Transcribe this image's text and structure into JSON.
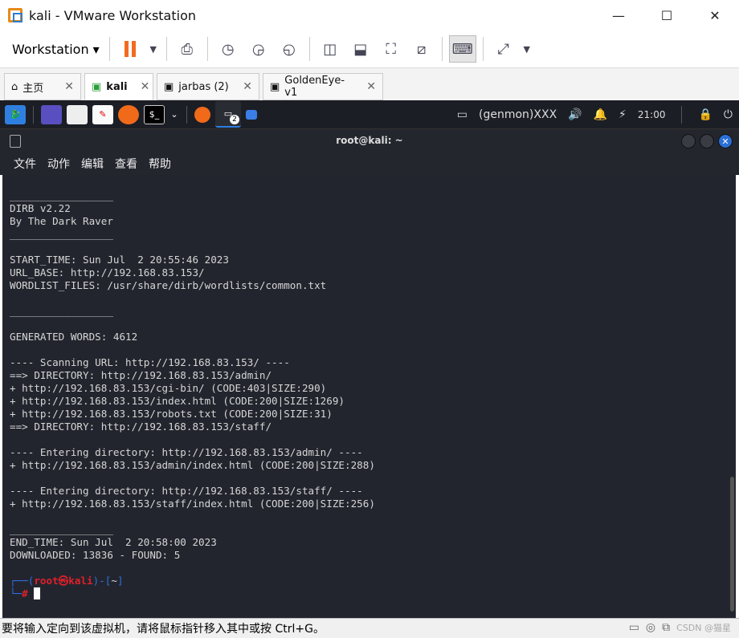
{
  "window": {
    "title": "kali - VMware Workstation",
    "min": "—",
    "max": "☐",
    "close": "✕"
  },
  "toolbar": {
    "workstation": "Workstation ▾"
  },
  "tabs": [
    {
      "label": "主页"
    },
    {
      "label": "kali"
    },
    {
      "label": "jarbas (2)"
    },
    {
      "label": "GoldenEye-v1"
    }
  ],
  "panel": {
    "badge": "2",
    "genmon": "(genmon)XXX",
    "clock": "21:00"
  },
  "terminal": {
    "title": "root@kali: ~",
    "menu": [
      "文件",
      "动作",
      "编辑",
      "查看",
      "帮助"
    ],
    "lines": [
      "_________________",
      "DIRB v2.22",
      "By The Dark Raver",
      "_________________",
      "",
      "START_TIME: Sun Jul  2 20:55:46 2023",
      "URL_BASE: http://192.168.83.153/",
      "WORDLIST_FILES: /usr/share/dirb/wordlists/common.txt",
      "",
      "_________________",
      "",
      "GENERATED WORDS: 4612",
      "",
      "---- Scanning URL: http://192.168.83.153/ ----",
      "==> DIRECTORY: http://192.168.83.153/admin/",
      "+ http://192.168.83.153/cgi-bin/ (CODE:403|SIZE:290)",
      "+ http://192.168.83.153/index.html (CODE:200|SIZE:1269)",
      "+ http://192.168.83.153/robots.txt (CODE:200|SIZE:31)",
      "==> DIRECTORY: http://192.168.83.153/staff/",
      "",
      "---- Entering directory: http://192.168.83.153/admin/ ----",
      "+ http://192.168.83.153/admin/index.html (CODE:200|SIZE:288)",
      "",
      "---- Entering directory: http://192.168.83.153/staff/ ----",
      "+ http://192.168.83.153/staff/index.html (CODE:200|SIZE:256)",
      "",
      "_________________",
      "END_TIME: Sun Jul  2 20:58:00 2023",
      "DOWNLOADED: 13836 - FOUND: 5",
      ""
    ],
    "prompt": {
      "pre": "┌──(",
      "user": "root㉿kali",
      "mid": ")-[",
      "dir": "~",
      "post": "]",
      "line2": "└─",
      "hash": "#"
    }
  },
  "status": {
    "text": "要将输入定向到该虚拟机，请将鼠标指针移入其中或按 Ctrl+G。",
    "watermark": "CSDN @猫星"
  }
}
